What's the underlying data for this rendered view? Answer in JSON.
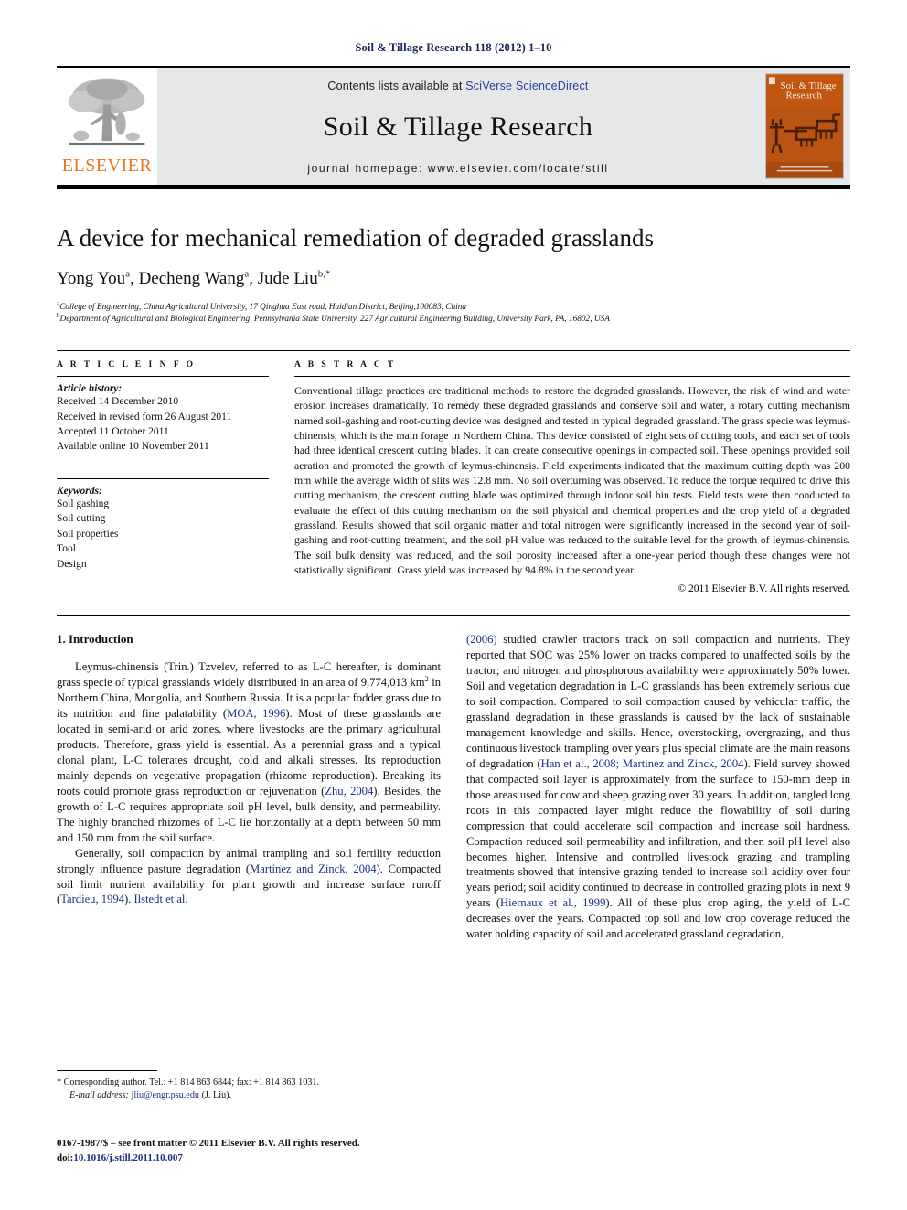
{
  "running_head": "Soil & Tillage Research 118 (2012) 1–10",
  "banner": {
    "publisher_logo_text": "ELSEVIER",
    "contents_prefix": "Contents lists available at ",
    "contents_link": "SciVerse ScienceDirect",
    "journal_title": "Soil & Tillage Research",
    "homepage_line": "journal homepage: www.elsevier.com/locate/still",
    "cover_title_line1": "Soil & Tillage",
    "cover_title_line2": "Research"
  },
  "article": {
    "title": "A device for mechanical remediation of degraded grasslands",
    "authors_parts": [
      {
        "name": "Yong You",
        "sup": "a",
        "sep": ", "
      },
      {
        "name": "Decheng Wang",
        "sup": "a",
        "sep": ", "
      },
      {
        "name": "Jude Liu",
        "sup": "b,*",
        "sep": ""
      }
    ],
    "affiliations": [
      {
        "mark": "a",
        "text": "College of Engineering, China Agricultural University, 17 Qinghua East road, Haidian District, Beijing,100083, China"
      },
      {
        "mark": "b",
        "text": "Department of Agricultural and Biological Engineering, Pennsylvania State University, 227 Agricultural Engineering Building, University Park, PA, 16802, USA"
      }
    ]
  },
  "article_info": {
    "heading": "A R T I C L E   I N F O",
    "history_label": "Article history:",
    "history": [
      "Received 14 December 2010",
      "Received in revised form 26 August 2011",
      "Accepted 11 October 2011",
      "Available online 10 November 2011"
    ],
    "keywords_label": "Keywords:",
    "keywords": [
      "Soil gashing",
      "Soil cutting",
      "Soil properties",
      "Tool",
      "Design"
    ]
  },
  "abstract": {
    "heading": "A B S T R A C T",
    "text": "Conventional tillage practices are traditional methods to restore the degraded grasslands. However, the risk of wind and water erosion increases dramatically. To remedy these degraded grasslands and conserve soil and water, a rotary cutting mechanism named soil-gashing and root-cutting device was designed and tested in typical degraded grassland. The grass specie was leymus-chinensis, which is the main forage in Northern China. This device consisted of eight sets of cutting tools, and each set of tools had three identical crescent cutting blades. It can create consecutive openings in compacted soil. These openings provided soil aeration and promoted the growth of leymus-chinensis. Field experiments indicated that the maximum cutting depth was 200 mm while the average width of slits was 12.8 mm. No soil overturning was observed. To reduce the torque required to drive this cutting mechanism, the crescent cutting blade was optimized through indoor soil bin tests. Field tests were then conducted to evaluate the effect of this cutting mechanism on the soil physical and chemical properties and the crop yield of a degraded grassland. Results showed that soil organic matter and total nitrogen were significantly increased in the second year of soil-gashing and root-cutting treatment, and the soil pH value was reduced to the suitable level for the growth of leymus-chinensis. The soil bulk density was reduced, and the soil porosity increased after a one-year period though these changes were not statistically significant. Grass yield was increased by 94.8% in the second year.",
    "copyright": "© 2011 Elsevier B.V. All rights reserved."
  },
  "body": {
    "section_number_title": "1. Introduction",
    "left_paragraphs": [
      {
        "runs": [
          {
            "t": "Leymus-chinensis (Trin.) Tzvelev, referred to as L-C hereafter, is dominant grass specie of typical grasslands widely distributed in an area of 9,774,013 km",
            "k": "n"
          },
          {
            "t": "2",
            "k": "sup"
          },
          {
            "t": " in Northern China, Mongolia, and Southern Russia. It is a popular fodder grass due to its nutrition and fine palatability (",
            "k": "n"
          },
          {
            "t": "MOA, 1996",
            "k": "c"
          },
          {
            "t": "). Most of these grasslands are located in semi-arid or arid zones, where livestocks are the primary agricultural products. Therefore, grass yield is essential. As a perennial grass and a typical clonal plant, L-C tolerates drought, cold and alkali stresses. Its reproduction mainly depends on vegetative propagation (rhizome reproduction). Breaking its roots could promote grass reproduction or rejuvenation (",
            "k": "n"
          },
          {
            "t": "Zhu, 2004",
            "k": "c"
          },
          {
            "t": "). Besides, the growth of L-C requires appropriate soil pH level, bulk density, and permeability. The highly branched rhizomes of L-C lie horizontally at a depth between 50 mm and 150 mm from the soil surface.",
            "k": "n"
          }
        ]
      },
      {
        "runs": [
          {
            "t": "Generally, soil compaction by animal trampling and soil fertility reduction strongly influence pasture degradation (",
            "k": "n"
          },
          {
            "t": "Martinez and Zinck, 2004",
            "k": "c"
          },
          {
            "t": "). Compacted soil limit nutrient availability for plant growth and increase surface runoff (",
            "k": "n"
          },
          {
            "t": "Tardieu, 1994",
            "k": "c"
          },
          {
            "t": "). ",
            "k": "n"
          },
          {
            "t": "Ilstedt et al.",
            "k": "c"
          }
        ]
      }
    ],
    "right_paragraphs": [
      {
        "runs": [
          {
            "t": "(2006)",
            "k": "c"
          },
          {
            "t": " studied crawler tractor's track on soil compaction and nutrients. They reported that SOC was 25% lower on tracks compared to unaffected soils by the tractor; and nitrogen and phosphorous availability were approximately 50% lower. Soil and vegetation degradation in L-C grasslands has been extremely serious due to soil compaction. Compared to soil compaction caused by vehicular traffic, the grassland degradation in these grasslands is caused by the lack of sustainable management knowledge and skills. Hence, overstocking, overgrazing, and thus continuous livestock trampling over years plus special climate are the main reasons of degradation (",
            "k": "n"
          },
          {
            "t": "Han et al., 2008; Martinez and Zinck, 2004",
            "k": "c"
          },
          {
            "t": "). Field survey showed that compacted soil layer is approximately from the surface to 150-mm deep in those areas used for cow and sheep grazing over 30 years. In addition, tangled long roots in this compacted layer might reduce the flowability of soil during compression that could accelerate soil compaction and increase soil hardness. Compaction reduced soil permeability and infiltration, and then soil pH level also becomes higher. Intensive and controlled livestock grazing and trampling treatments showed that intensive grazing tended to increase soil acidity over four years period; soil acidity continued to decrease in controlled grazing plots in next 9 years (",
            "k": "n"
          },
          {
            "t": "Hiernaux et al., 1999",
            "k": "c"
          },
          {
            "t": "). All of these plus crop aging, the yield of L-C decreases over the years. Compacted top soil and low crop coverage reduced the water holding capacity of soil and accelerated grassland degradation,",
            "k": "n"
          }
        ]
      }
    ]
  },
  "footnotes": {
    "corresponding": "* Corresponding author. Tel.: +1 814 863 6844; fax: +1 814 863 1031.",
    "email_label": "E-mail address:",
    "email": "jliu@engr.psu.edu",
    "email_suffix": "(J. Liu).",
    "imprint_line": "0167-1987/$ – see front matter © 2011 Elsevier B.V. All rights reserved.",
    "doi_label": "doi:",
    "doi_value": "10.1016/j.still.2011.10.007"
  },
  "colors": {
    "running_head": "#16235e",
    "link": "#2b3f9e",
    "citation": "#1b2f86",
    "elsevier_orange": "#E87722",
    "banner_gray": "#e6e7e8",
    "cover_orange": "#c45a16"
  }
}
